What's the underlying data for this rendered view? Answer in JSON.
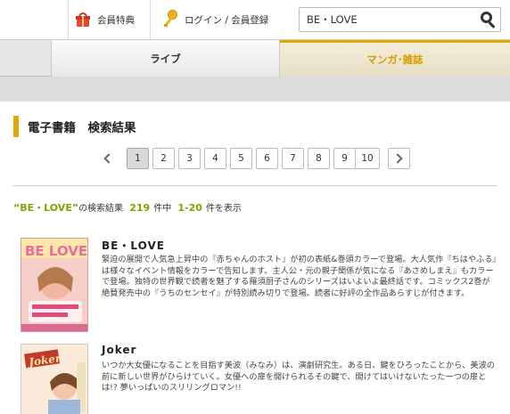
{
  "header": {
    "member_label": "会員特典",
    "login_label": "ログイン / 会員登録",
    "search_value": "BE・LOVE"
  },
  "tabs": [
    {
      "label": "ライブ"
    },
    {
      "label": "マンガ･雑誌"
    }
  ],
  "heading": "電子書籍　検索結果",
  "pagination": {
    "pages": [
      "1",
      "2",
      "3",
      "4",
      "5",
      "6",
      "7",
      "8",
      "9",
      "10"
    ],
    "current": "1"
  },
  "summary": {
    "keyword": "“BE・LOVE”",
    "keyword_suffix": "の検索結果",
    "total": "219",
    "total_suffix": "件中",
    "range": "1-20",
    "range_suffix": "件を表示"
  },
  "results": [
    {
      "title": "BE・LOVE",
      "description": "緊迫の展開で人気急上昇中の『赤ちゃんのホスト』が初の表紙&巻頭カラーで登場。大人気作『ちはやふる』は様々なイベント情報をカラーで告知します。主人公・元の親子関係が気になる『あさめしまえ』もカラーで登場。独特の世界観で読者を魅了する羅須厨子さんのシリーズはいよいよ最終話です。コミックス2巻が絶賛発売中の『うちのセンセイ』が特別読み切りで登場。読者に好評の全作品あらすじが付きます。",
      "cover_text": "BE LOVE"
    },
    {
      "title": "Joker",
      "description": "いつか大女優になることを目指す美波（みなみ）は、演劇研究生。ある日、鍵をひろったことから、美波の前に新しい世界がひらけていく。女優への扉を開けられるその鍵で、開けてはいけないたった一つの扉とは!? 夢いっぱいのスリリングロマン!!",
      "cover_text": "Joker"
    }
  ],
  "colors": {
    "accent": "#e0a800",
    "green": "#7aa600"
  }
}
